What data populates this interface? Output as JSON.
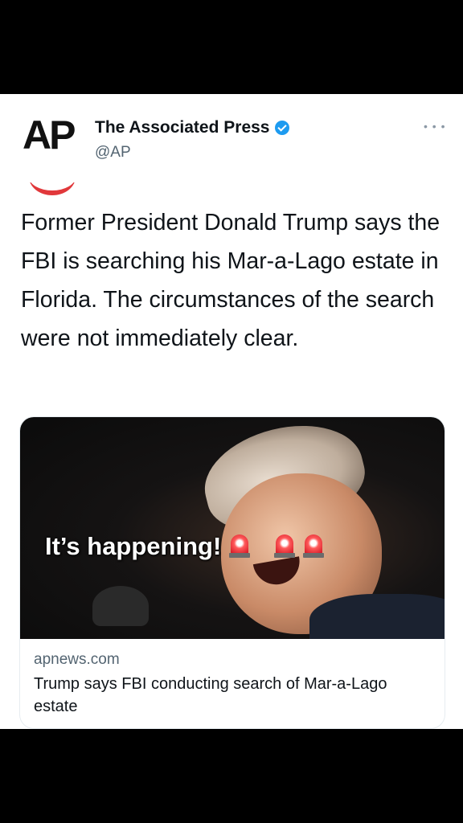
{
  "tweet": {
    "account": {
      "logo_text": "AP",
      "display_name": "The Associated Press",
      "handle": "@AP",
      "verified": true
    },
    "more_menu_icon": "ellipsis-icon",
    "text": "Former President Donald Trump says the FBI is searching his Mar-a-Lago estate in Florida. The circumstances of the search were not immediately clear.",
    "link_card": {
      "overlay_caption": "It’s happening!",
      "overlay_emoji_icons": [
        "police-siren-icon",
        "police-siren-icon",
        "police-siren-icon"
      ],
      "domain": "apnews.com",
      "headline": "Trump says FBI conducting search of Mar-a-Lago estate"
    }
  },
  "colors": {
    "background": "#000000",
    "verified_badge": "#1d9bf0",
    "ap_logo_accent": "#e1383b",
    "secondary_text": "#536471"
  }
}
